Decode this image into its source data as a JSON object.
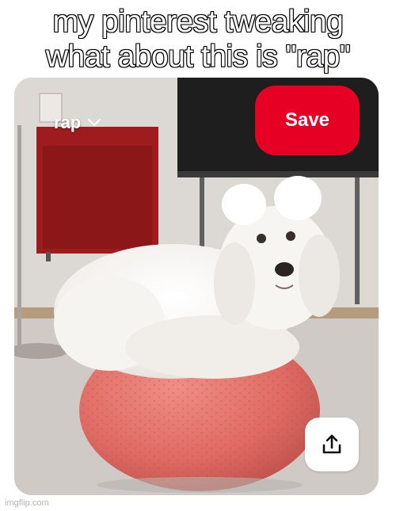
{
  "caption": {
    "line1": "my pinterest tweaking",
    "line2": "what about this is \"rap\""
  },
  "pin": {
    "board_name": "rap",
    "save_label": "Save",
    "share_icon": "share-upload-icon",
    "chevron_icon": "chevron-down-icon"
  },
  "watermark": "imgflip.com",
  "colors": {
    "save_red": "#e60023",
    "ball_red": "#e06a64",
    "dog_white": "#f4f2ef"
  }
}
